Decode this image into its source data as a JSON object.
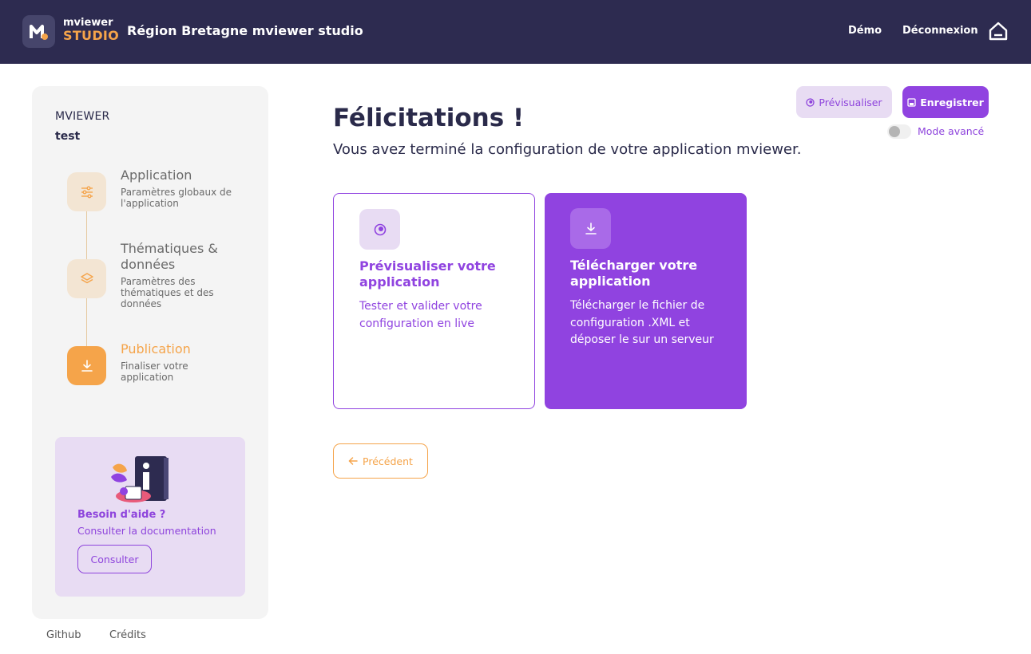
{
  "header": {
    "logo_top": "mviewer",
    "logo_bottom": "STUDIO",
    "title": "Région Bretagne mviewer studio",
    "nav": {
      "demo": "Démo",
      "logout": "Déconnexion"
    },
    "home_icon": "home-icon"
  },
  "sidebar": {
    "project_label": "MVIEWER",
    "project_name": "test",
    "steps": [
      {
        "title": "Application",
        "description": "Paramètres globaux de l'application",
        "icon": "sliders-icon",
        "active": false
      },
      {
        "title": "Thématiques & données",
        "description": "Paramètres des thématiques et des données",
        "icon": "layers-icon",
        "active": false
      },
      {
        "title": "Publication",
        "description": "Finaliser votre application",
        "icon": "download-icon",
        "active": true
      }
    ],
    "help": {
      "title": "Besoin d'aide ?",
      "subtitle": "Consulter la documentation",
      "button": "Consulter"
    }
  },
  "footer": {
    "github": "Github",
    "credits": "Crédits"
  },
  "toolbar": {
    "preview_label": "Prévisualiser",
    "save_label": "Enregistrer",
    "advanced_mode_label": "Mode avancé",
    "advanced_mode_on": false
  },
  "main": {
    "title": "Félicitations !",
    "subtitle": "Vous avez terminé la configuration de votre application mviewer.",
    "cards": [
      {
        "title": "Prévisualiser votre application",
        "description": "Tester et valider votre configuration en live",
        "icon": "eye-icon"
      },
      {
        "title": "Télécharger votre application",
        "description": "Télécharger le fichier de configuration .XML et déposer le sur un serveur",
        "icon": "download-icon"
      }
    ],
    "previous_label": "Précédent"
  },
  "colors": {
    "header_bg": "#2d2b50",
    "accent_purple": "#9043e0",
    "accent_orange": "#f5a44a",
    "light_purple": "#e8dcf3",
    "sidebar_bg": "#f4f4f4"
  }
}
